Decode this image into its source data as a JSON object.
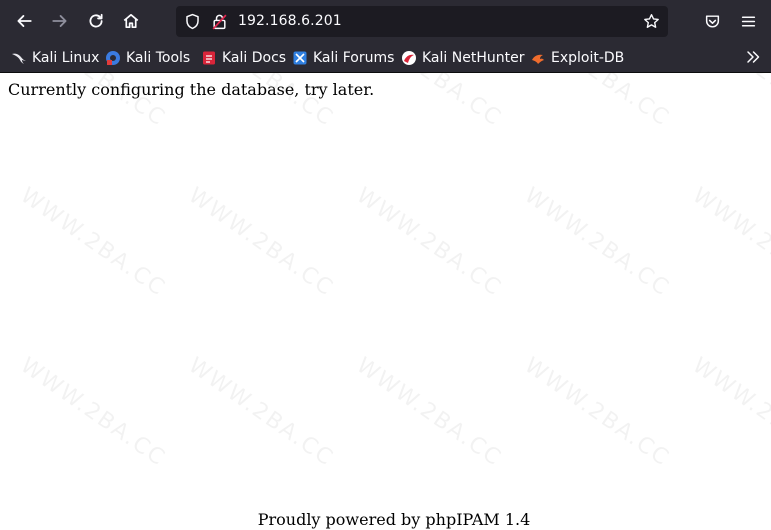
{
  "browser": {
    "url": "192.168.6.201",
    "bookmarks": [
      {
        "label": "Kali Linux",
        "icon": "kali-dragon-icon"
      },
      {
        "label": "Kali Tools",
        "icon": "kali-tools-icon"
      },
      {
        "label": "Kali Docs",
        "icon": "kali-docs-icon"
      },
      {
        "label": "Kali Forums",
        "icon": "kali-forums-icon"
      },
      {
        "label": "Kali NetHunter",
        "icon": "kali-nethunter-icon"
      },
      {
        "label": "Exploit-DB",
        "icon": "exploit-db-icon"
      }
    ]
  },
  "page": {
    "message": "Currently configuring the database, try later.",
    "footer": "Proudly powered by phpIPAM 1.4"
  },
  "watermark": {
    "text": "WWW.2BA.CC"
  },
  "colors": {
    "chrome_bg": "#2b2a33",
    "urlbar_bg": "#1c1b22",
    "chrome_text": "#fbfbfe",
    "page_bg": "#ffffff"
  }
}
